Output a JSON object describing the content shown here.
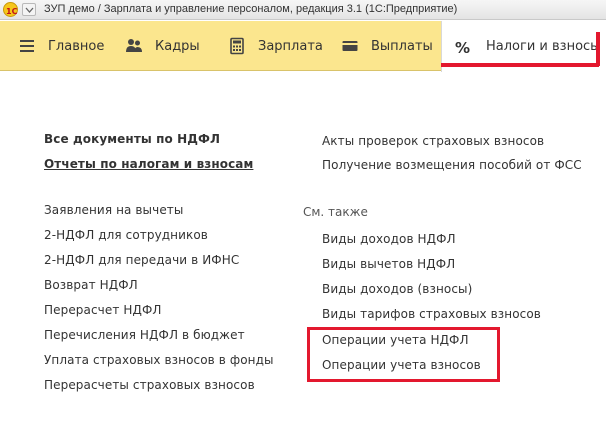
{
  "window": {
    "title": "ЗУП демо / Зарплата и управление персоналом, редакция 3.1  (1С:Предприятие)"
  },
  "sections": [
    {
      "label": "Главное",
      "icon": "menu-lines-icon"
    },
    {
      "label": "Кадры",
      "icon": "people-icon"
    },
    {
      "label": "Зарплата",
      "icon": "calculator-icon"
    },
    {
      "label": "Выплаты",
      "icon": "wallet-icon"
    },
    {
      "label": "Налоги и взносы",
      "icon": "percent-icon",
      "active": true
    }
  ],
  "left_column": {
    "top_links": [
      "Все документы по НДФЛ",
      "Отчеты по налогам и взносам"
    ],
    "links": [
      "Заявления на вычеты",
      "2-НДФЛ для сотрудников",
      "2-НДФЛ для передачи в ИФНС",
      "Возврат НДФЛ",
      "Перерасчет НДФЛ",
      "Перечисления НДФЛ в бюджет",
      "Уплата страховых взносов в фонды",
      "Перерасчеты страховых взносов"
    ]
  },
  "right_column": {
    "top_links": [
      "Акты проверок страховых взносов",
      "Получение возмещения пособий от ФСС"
    ],
    "see_also_label": "См. также",
    "see_also": [
      "Виды доходов НДФЛ",
      "Виды вычетов НДФЛ",
      "Виды доходов (взносы)",
      "Виды тарифов страховых взносов",
      "Операции учета НДФЛ",
      "Операции учета взносов"
    ]
  },
  "colors": {
    "section_bar": "#fbe68e",
    "highlight": "#e3182e",
    "text": "#333333"
  }
}
